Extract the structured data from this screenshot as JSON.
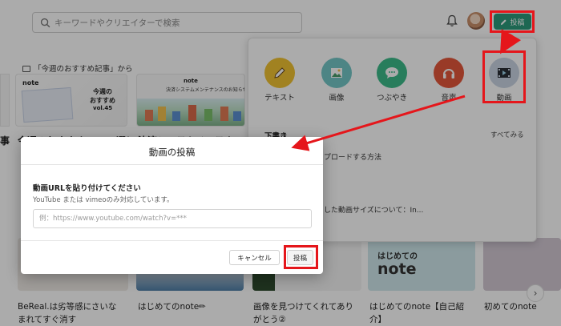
{
  "header": {
    "search_placeholder": "キーワードやクリエイターで検索",
    "post_label": "投稿"
  },
  "section": {
    "title": "「今週のおすすめ記事」から"
  },
  "cards": [
    {
      "thumb_brand": "note",
      "thumb_title": "今週の\nおすすめ",
      "thumb_vol": "vol.45",
      "title": "今週のおすすめnote5選！"
    },
    {
      "thumb_brand": "note",
      "thumb_title": "決済システムメンテナンスのお知らせ",
      "title": "決済システムメンテナンス"
    }
  ],
  "left_stub_text": "事",
  "post_menu": {
    "items": [
      {
        "label": "テキスト",
        "color": "#f1c232",
        "icon": "pencil-icon"
      },
      {
        "label": "画像",
        "color": "#74c6c6",
        "icon": "image-icon"
      },
      {
        "label": "つぶやき",
        "color": "#3dbb8a",
        "icon": "speech-bubble-icon"
      },
      {
        "label": "音声",
        "color": "#e4573b",
        "icon": "headphones-icon"
      },
      {
        "label": "動画",
        "color": "#c9d4e3",
        "icon": "film-icon"
      }
    ],
    "drafts_label": "下書き",
    "see_all": "すべてみる",
    "draft_rows": [
      "プロードする方法",
      "した動画サイズについて：In..."
    ]
  },
  "modal": {
    "title": "動画の投稿",
    "field_label": "動画URLを貼り付けてください",
    "note": "YouTube または vimeoのみ対応しています。",
    "placeholder": "例：https://www.youtube.com/watch?v=***",
    "cancel": "キャンセル",
    "submit": "投稿"
  },
  "bottom": {
    "thumb4_line1": "はじめての",
    "thumb4_line2": "note",
    "titles": [
      "BeReal.は劣等感にさいな\nまれてすぐ消す",
      "はじめてのnote✏",
      "画像を見つけてくれてあり\nがとう②",
      "はじめてのnote【自己紹\n介】",
      "初めてのnote"
    ]
  },
  "colors": {
    "accent": "#2c9a7b",
    "highlight": "#e5161b"
  }
}
